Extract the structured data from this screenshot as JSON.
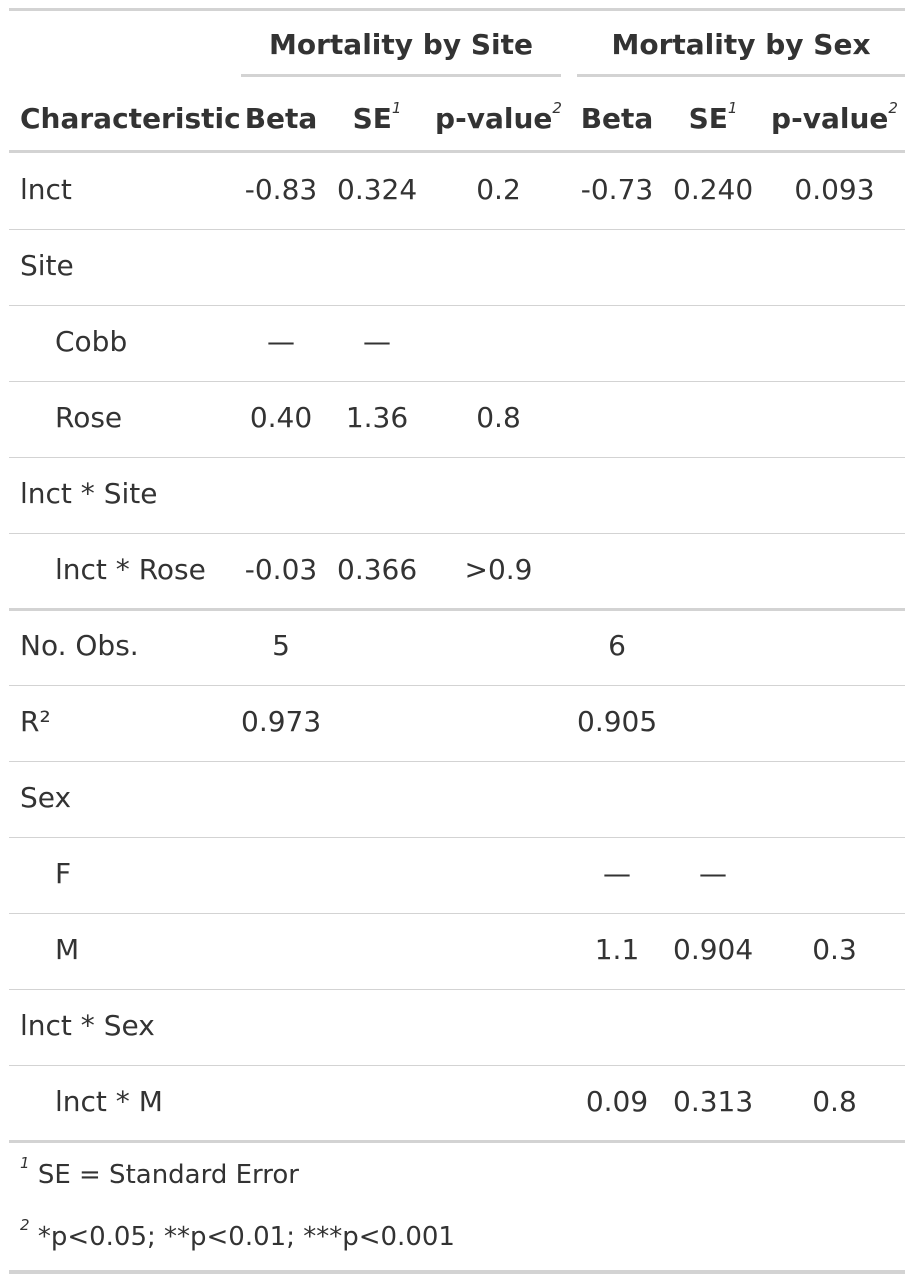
{
  "table": {
    "spanners": [
      {
        "label": "Mortality by Site"
      },
      {
        "label": "Mortality by Sex"
      }
    ],
    "columns": {
      "characteristic": "Characteristic",
      "beta": "Beta",
      "se": "SE",
      "pvalue": "p-value",
      "se_note": "1",
      "pvalue_note": "2"
    },
    "rows": [
      {
        "label": "lnct",
        "indent": false,
        "site_beta": "-0.83",
        "site_se": "0.324",
        "site_p": "0.2",
        "sex_beta": "-0.73",
        "sex_se": "0.240",
        "sex_p": "0.093"
      },
      {
        "label": "Site",
        "indent": false,
        "site_beta": "",
        "site_se": "",
        "site_p": "",
        "sex_beta": "",
        "sex_se": "",
        "sex_p": ""
      },
      {
        "label": "Cobb",
        "indent": true,
        "site_beta": "—",
        "site_se": "—",
        "site_p": "",
        "sex_beta": "",
        "sex_se": "",
        "sex_p": ""
      },
      {
        "label": "Rose",
        "indent": true,
        "site_beta": "0.40",
        "site_se": "1.36",
        "site_p": "0.8",
        "sex_beta": "",
        "sex_se": "",
        "sex_p": ""
      },
      {
        "label": "lnct * Site",
        "indent": false,
        "site_beta": "",
        "site_se": "",
        "site_p": "",
        "sex_beta": "",
        "sex_se": "",
        "sex_p": ""
      },
      {
        "label": "lnct * Rose",
        "indent": true,
        "site_beta": "-0.03",
        "site_se": "0.366",
        "site_p": ">0.9",
        "sex_beta": "",
        "sex_se": "",
        "sex_p": ""
      },
      {
        "label": "No. Obs.",
        "indent": false,
        "site_beta": "5",
        "site_se": "",
        "site_p": "",
        "sex_beta": "6",
        "sex_se": "",
        "sex_p": ""
      },
      {
        "label": "R²",
        "indent": false,
        "site_beta": "0.973",
        "site_se": "",
        "site_p": "",
        "sex_beta": "0.905",
        "sex_se": "",
        "sex_p": ""
      },
      {
        "label": "Sex",
        "indent": false,
        "site_beta": "",
        "site_se": "",
        "site_p": "",
        "sex_beta": "",
        "sex_se": "",
        "sex_p": ""
      },
      {
        "label": "F",
        "indent": true,
        "site_beta": "",
        "site_se": "",
        "site_p": "",
        "sex_beta": "—",
        "sex_se": "—",
        "sex_p": ""
      },
      {
        "label": "M",
        "indent": true,
        "site_beta": "",
        "site_se": "",
        "site_p": "",
        "sex_beta": "1.1",
        "sex_se": "0.904",
        "sex_p": "0.3"
      },
      {
        "label": "lnct * Sex",
        "indent": false,
        "site_beta": "",
        "site_se": "",
        "site_p": "",
        "sex_beta": "",
        "sex_se": "",
        "sex_p": ""
      },
      {
        "label": "lnct * M",
        "indent": true,
        "site_beta": "",
        "site_se": "",
        "site_p": "",
        "sex_beta": "0.09",
        "sex_se": "0.313",
        "sex_p": "0.8"
      }
    ],
    "footnotes": [
      {
        "mark": "1",
        "text": "SE = Standard Error"
      },
      {
        "mark": "2",
        "text": "*p<0.05; **p<0.01; ***p<0.001"
      }
    ]
  },
  "colors": {
    "rule": "#d3d3d3",
    "text": "#333333"
  }
}
